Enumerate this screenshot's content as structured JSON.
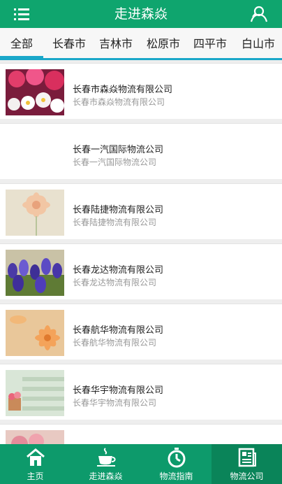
{
  "header": {
    "title": "走进森焱"
  },
  "categories": [
    {
      "label": "全部"
    },
    {
      "label": "长春市"
    },
    {
      "label": "吉林市"
    },
    {
      "label": "松原市"
    },
    {
      "label": "四平市"
    },
    {
      "label": "白山市"
    }
  ],
  "companies": [
    {
      "name": "长春市森焱物流有限公司",
      "subtitle": "长春市森焱物流有限公司",
      "image": "pink-white-flowers"
    },
    {
      "name": "长春一汽国际物流公司",
      "subtitle": "长春一汽国际物流公司",
      "image": "blank"
    },
    {
      "name": "长春陆捷物流有限公司",
      "subtitle": "长春陆捷物流有限公司",
      "image": "peach-daisy"
    },
    {
      "name": "长春龙达物流有限公司",
      "subtitle": "长春龙达物流有限公司",
      "image": "purple-crocus"
    },
    {
      "name": "长春航华物流有限公司",
      "subtitle": "长春航华物流有限公司",
      "image": "orange-cosmos"
    },
    {
      "name": "长春华宇物流有限公司",
      "subtitle": "长春华宇物流有限公司",
      "image": "flower-pot-stairs"
    },
    {
      "name": "",
      "subtitle": "",
      "image": "pink-roses"
    }
  ],
  "tabs": [
    {
      "label": "主页",
      "icon": "home-icon"
    },
    {
      "label": "走进森焱",
      "icon": "cup-icon"
    },
    {
      "label": "物流指南",
      "icon": "timer-icon"
    },
    {
      "label": "物流公司",
      "icon": "news-icon"
    }
  ],
  "colors": {
    "header": "#0fa56e",
    "accent": "#1aa7c9",
    "tabbar": "#0d9a6b",
    "tab_active": "#0a8459"
  }
}
